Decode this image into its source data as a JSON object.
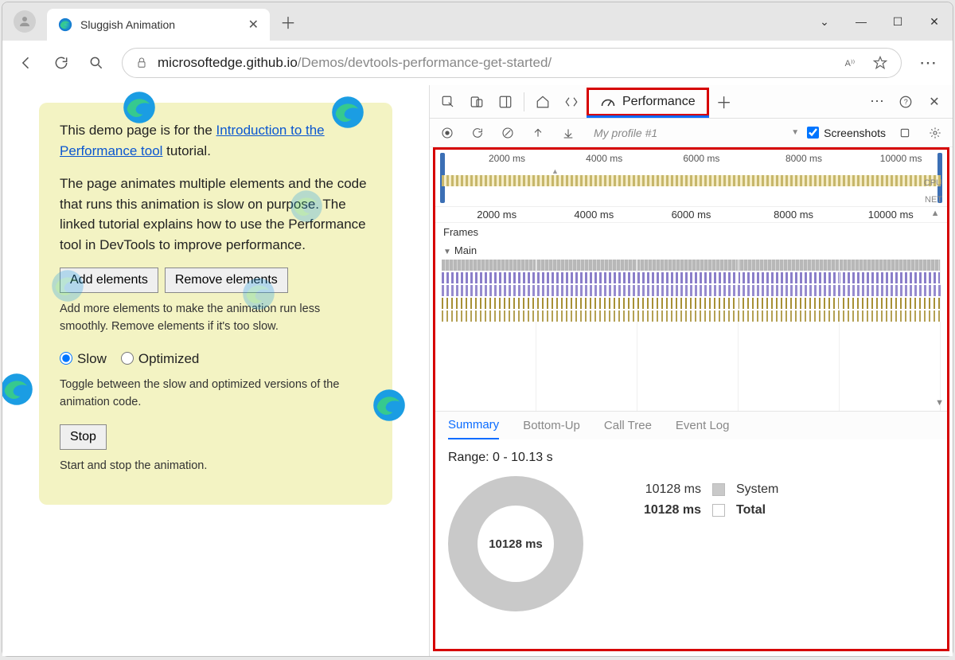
{
  "browser": {
    "tab_title": "Sluggish Animation",
    "url_host": "microsoftedge.github.io",
    "url_path": "/Demos/devtools-performance-get-started/"
  },
  "page": {
    "intro_prefix": "This demo page is for the ",
    "intro_link": "Introduction to the Performance tool",
    "intro_suffix": " tutorial.",
    "body": "The page animates multiple elements and the code that runs this animation is slow on purpose. The linked tutorial explains how to use the Performance tool in DevTools to improve performance.",
    "add_btn": "Add elements",
    "remove_btn": "Remove elements",
    "add_hint": "Add more elements to make the animation run less smoothly. Remove elements if it's too slow.",
    "radio_slow": "Slow",
    "radio_opt": "Optimized",
    "toggle_hint": "Toggle between the slow and optimized versions of the animation code.",
    "stop_btn": "Stop",
    "stop_hint": "Start and stop the animation."
  },
  "devtools": {
    "perf_tab": "Performance",
    "profile_name": "My profile #1",
    "screenshots_label": "Screenshots",
    "overview_ticks": [
      "2000 ms",
      "4000 ms",
      "6000 ms",
      "8000 ms",
      "10000 ms"
    ],
    "cpu_label": "CPU",
    "net_label": "NET",
    "flame_ticks": [
      "2000 ms",
      "4000 ms",
      "6000 ms",
      "8000 ms",
      "10000 ms"
    ],
    "frames_label": "Frames",
    "main_label": "Main",
    "bottom_tabs": {
      "summary": "Summary",
      "bottomup": "Bottom-Up",
      "calltree": "Call Tree",
      "eventlog": "Event Log"
    },
    "range_text": "Range: 0 - 10.13 s",
    "total_ms": "10128 ms",
    "legend_system_ms": "10128 ms",
    "legend_system": "System",
    "legend_total_ms": "10128 ms",
    "legend_total": "Total"
  }
}
